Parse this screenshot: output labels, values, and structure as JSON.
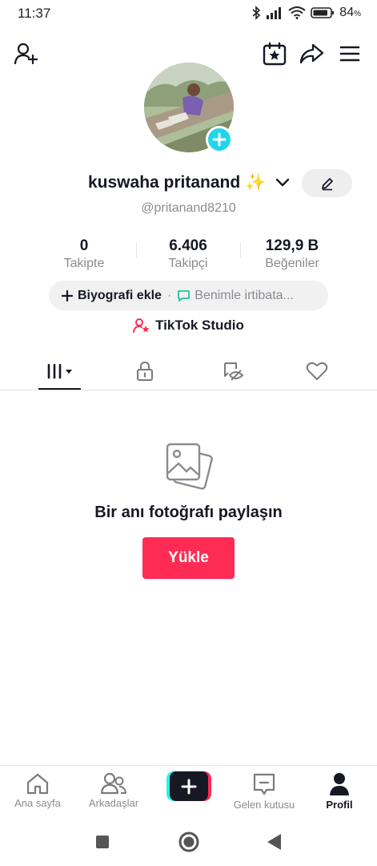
{
  "status_bar": {
    "time": "11:37",
    "battery": "84",
    "battery_unit": "%"
  },
  "profile": {
    "name": "kuswaha pritanand ✨",
    "handle": "@pritanand8210"
  },
  "stats": [
    {
      "value": "0",
      "label": "Takipte"
    },
    {
      "value": "6.406",
      "label": "Takipçi"
    },
    {
      "value": "129,9 B",
      "label": "Beğeniler"
    }
  ],
  "bio": {
    "add_label": "Biyografi ekle",
    "separator": "·",
    "contact_label": "Benimle irtibata..."
  },
  "studio": {
    "label": "TikTok Studio"
  },
  "empty_state": {
    "title": "Bir anı fotoğrafı paylaşın",
    "upload_label": "Yükle"
  },
  "bottom_nav": [
    {
      "label": "Ana sayfa",
      "icon": "home-icon"
    },
    {
      "label": "Arkadaşlar",
      "icon": "friends-icon"
    },
    {
      "label": "",
      "icon": "plus-icon"
    },
    {
      "label": "Gelen kutusu",
      "icon": "inbox-icon"
    },
    {
      "label": "Profil",
      "icon": "profile-icon",
      "active": true
    }
  ],
  "colors": {
    "accent": "#fe2c55",
    "cyan": "#25f4ee",
    "avatar_badge": "#20d5ec",
    "text": "#161823",
    "muted": "#8a8b91"
  }
}
